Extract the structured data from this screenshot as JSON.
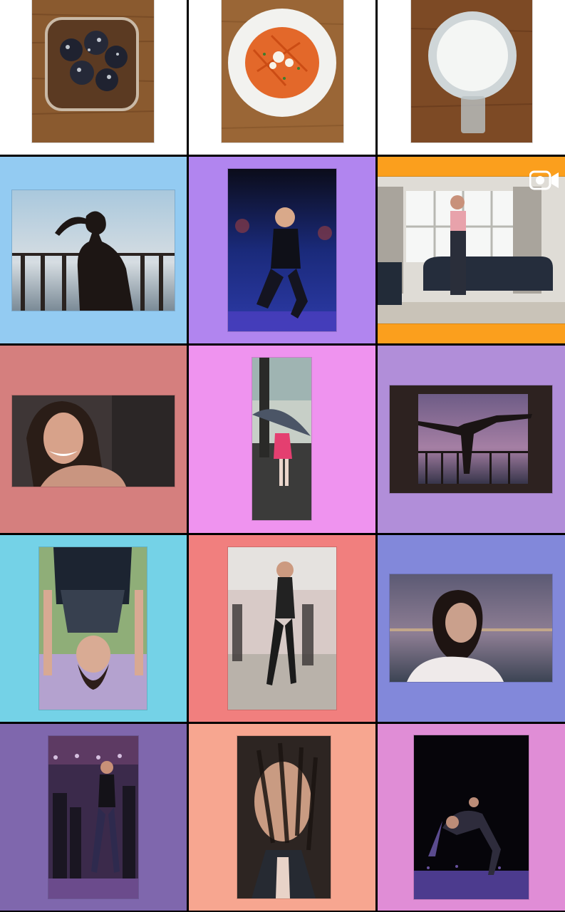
{
  "grid": {
    "tiles": [
      {
        "bg": "#ffffff",
        "photo_name": "bowl-of-dark-sweets-photo",
        "has_video": false
      },
      {
        "bg": "#ffffff",
        "photo_name": "carrot-salad-photo",
        "has_video": false
      },
      {
        "bg": "#ffffff",
        "photo_name": "blender-drink-photo",
        "has_video": false
      },
      {
        "bg": "#93cbf2",
        "photo_name": "silhouette-balcony-photo",
        "has_video": false
      },
      {
        "bg": "#b185ef",
        "photo_name": "gym-lunge-photo",
        "has_video": false
      },
      {
        "bg": "#fb9f1d",
        "photo_name": "living-room-workout-video",
        "has_video": true
      },
      {
        "bg": "#d57f7e",
        "photo_name": "smiling-portrait-photo",
        "has_video": false
      },
      {
        "bg": "#ef93ef",
        "photo_name": "umbrella-rain-photo",
        "has_video": false
      },
      {
        "bg": "#b18ed9",
        "photo_name": "yoga-pose-window-photo",
        "has_video": false
      },
      {
        "bg": "#74d2e7",
        "photo_name": "upside-down-bend-photo",
        "has_video": false
      },
      {
        "bg": "#f17f7e",
        "photo_name": "outdoor-dance-photo",
        "has_video": false
      },
      {
        "bg": "#8288da",
        "photo_name": "seaside-portrait-photo",
        "has_video": false
      },
      {
        "bg": "#7f67ad",
        "photo_name": "stage-dance-class-photo",
        "has_video": false
      },
      {
        "bg": "#f7a690",
        "photo_name": "hair-over-face-photo",
        "has_video": false
      },
      {
        "bg": "#e08dd6",
        "photo_name": "night-stretch-photo",
        "has_video": false
      }
    ]
  }
}
